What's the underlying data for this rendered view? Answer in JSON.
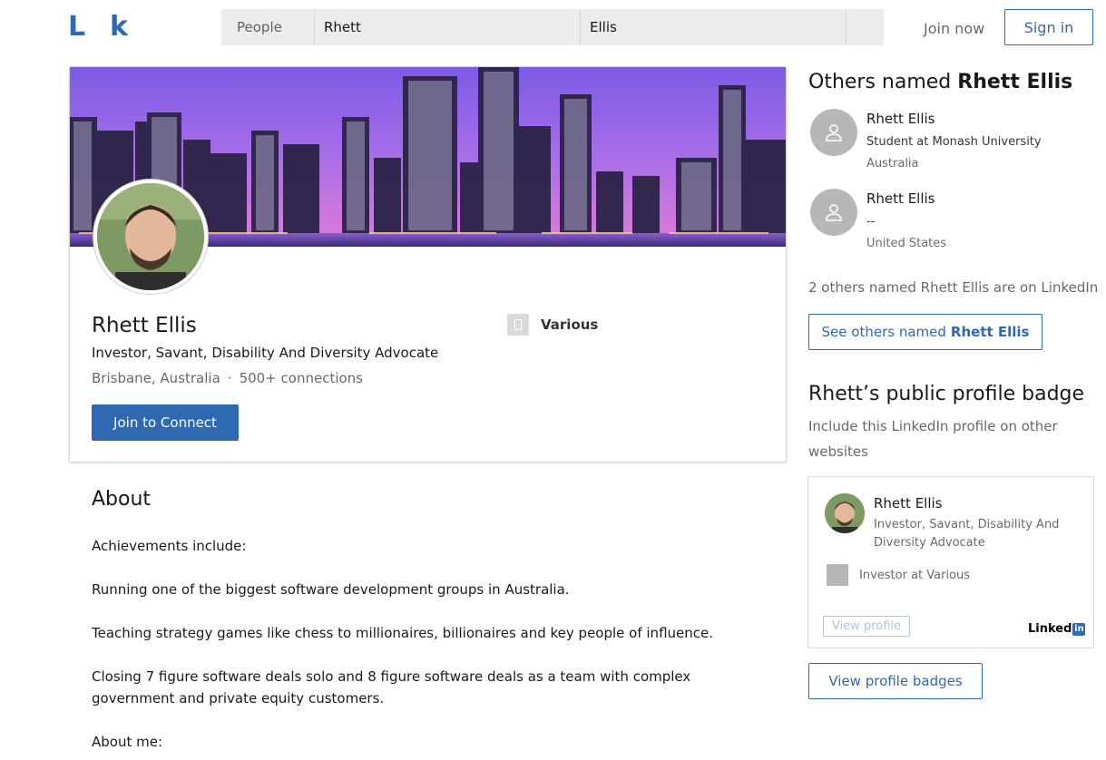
{
  "header": {
    "logo_left": "L",
    "logo_right": "k",
    "search": {
      "category": "People",
      "first_name": "Rhett",
      "last_name": "Ellis"
    },
    "join_now": "Join now",
    "sign_in": "Sign in"
  },
  "profile": {
    "name": "Rhett Ellis",
    "headline": "Investor, Savant, Disability And Diversity Advocate",
    "location": "Brisbane, Australia",
    "separator": "·",
    "connections": "500+ connections",
    "join_button": "Join to Connect",
    "company": "Various"
  },
  "about": {
    "title": "About",
    "paragraphs": [
      "Achievements include:",
      "Running one of the biggest software development groups in Australia.",
      "Teaching strategy games like chess to millionaires, billionaires and key people of influence.",
      "Closing 7 figure software deals solo and 8 figure software deals as a team with complex government and private equity customers.",
      "About me:"
    ]
  },
  "sidebar": {
    "others_title_prefix": "Others named",
    "others_title_name": "Rhett Ellis",
    "people": [
      {
        "name": "Rhett Ellis",
        "title": "Student at Monash University",
        "location": "Australia"
      },
      {
        "name": "Rhett Ellis",
        "title": "--",
        "location": "United States"
      }
    ],
    "others_count": "2 others named Rhett Ellis are on LinkedIn",
    "see_others_prefix": "See others named",
    "see_others_name": "Rhett Ellis",
    "badge_title": "Rhett’s public profile badge",
    "badge_subtitle": "Include this LinkedIn profile on other websites",
    "badge": {
      "name": "Rhett Ellis",
      "headline": "Investor, Savant, Disability And Diversity Advocate",
      "position": "Investor at Various",
      "view_profile": "View profile",
      "logo_text": "Linked",
      "logo_in": "in"
    },
    "view_badges": "View profile badges"
  },
  "colors": {
    "brand_blue": "#2e69b2",
    "search_bg": "#eaeced"
  }
}
